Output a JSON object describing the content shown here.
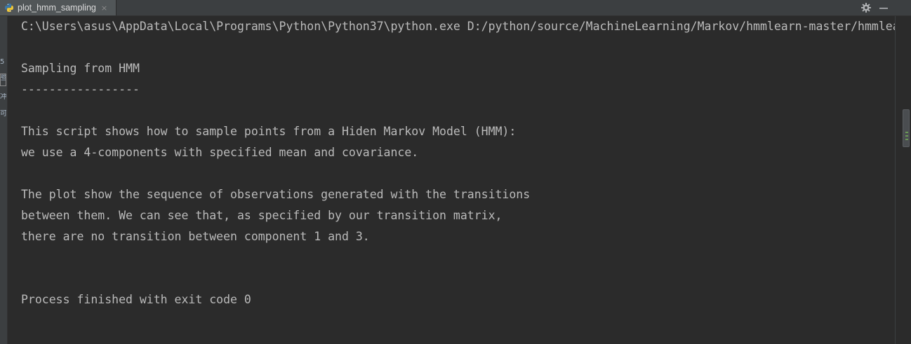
{
  "tab": {
    "label": "plot_hmm_sampling",
    "close_glyph": "×",
    "icon": "python-file-icon"
  },
  "toolbar": {
    "settings_icon": "gear-icon",
    "minimize_icon": "minimize-icon"
  },
  "gutter": {
    "glyphs": [
      "5",
      "些",
      "冲",
      "可"
    ]
  },
  "console": {
    "lines": [
      "C:\\Users\\asus\\AppData\\Local\\Programs\\Python\\Python37\\python.exe D:/python/source/MachineLearning/Markov/hmmlearn-master/hmmlearn-master/examples/plot_hmm_sampling.py",
      "",
      "Sampling from HMM",
      "-----------------",
      "",
      "This script shows how to sample points from a Hiden Markov Model (HMM):",
      "we use a 4-components with specified mean and covariance.",
      "",
      "The plot show the sequence of observations generated with the transitions",
      "between them. We can see that, as specified by our transition matrix,",
      "there are no transition between component 1 and 3.",
      "",
      "",
      "Process finished with exit code 0"
    ]
  },
  "colors": {
    "background": "#2b2b2b",
    "text": "#bbbbbb",
    "tabbar": "#3c3f41",
    "active_tab": "#515658"
  }
}
